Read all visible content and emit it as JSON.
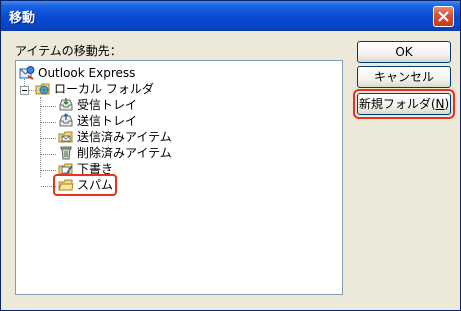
{
  "window": {
    "title": "移動"
  },
  "dialog": {
    "destination_label": "アイテムの移動先："
  },
  "tree": {
    "root": "Outlook Express",
    "local": "ローカル フォルダ",
    "inbox": "受信トレイ",
    "outbox": "送信トレイ",
    "sent": "送信済みアイテム",
    "deleted": "削除済みアイテム",
    "drafts": "下書き",
    "spam": "スパム"
  },
  "buttons": {
    "ok": "OK",
    "cancel": "キャンセル",
    "new_folder": "新規フォルダ(",
    "new_folder_key": "N",
    "new_folder_end": ")"
  },
  "colors": {
    "title_bar": "#0a4bd5",
    "dialog_bg": "#ece9d8",
    "highlight": "#e8331c"
  }
}
